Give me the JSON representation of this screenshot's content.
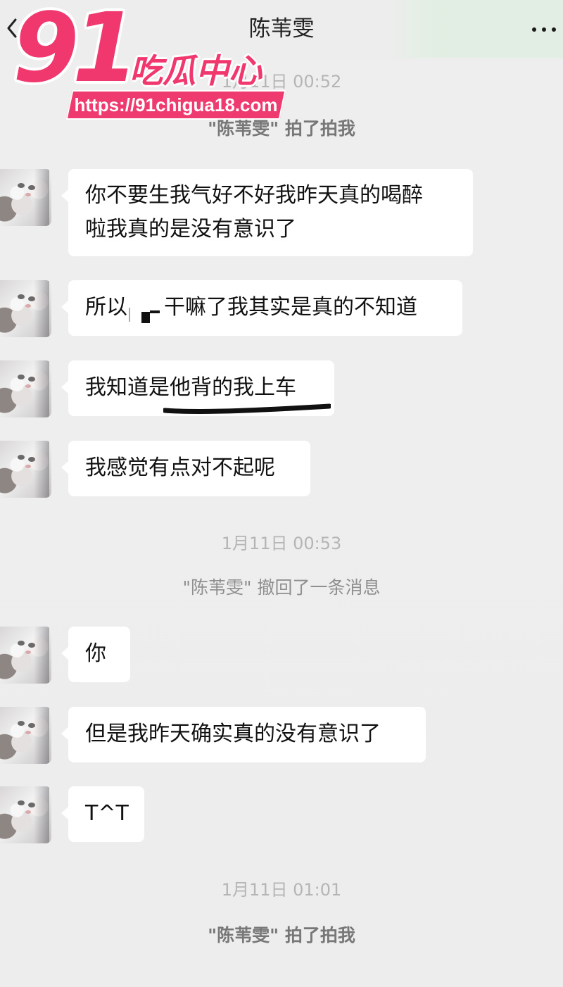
{
  "header": {
    "title": "陈苇雯",
    "back_icon": "chevron-left-icon",
    "more_icon": "more-dots-icon"
  },
  "watermark": {
    "number": "91",
    "brand": "吃瓜中心",
    "url": "https://91chigua18.com",
    "color": "#f0386e"
  },
  "chat": {
    "timestamps": [
      "1月11日 00:52",
      "1月11日 00:53",
      "1月11日 01:01"
    ],
    "system_messages": {
      "pat_1": "\"陈苇雯\" 拍了拍我",
      "recall": "\"陈苇雯\" 撤回了一条消息",
      "pat_2": "\"陈苇雯\" 拍了拍我"
    },
    "messages": [
      {
        "line1": "你不要生我气好不好我昨天真的喝醉",
        "line2": "啦我真的是没有意识了"
      },
      {
        "prefix": "所以",
        "suffix": "干嘛了我其实是真的不知道"
      },
      {
        "text": "我知道是他背的我上车"
      },
      {
        "text": "我感觉有点对不起呢"
      },
      {
        "text": "你"
      },
      {
        "text": "但是我昨天确实真的没有意识了"
      },
      {
        "text": "T^T"
      }
    ]
  },
  "colors": {
    "background": "#ededed",
    "bubble": "#ffffff",
    "system_text": "#8f8f8f"
  }
}
